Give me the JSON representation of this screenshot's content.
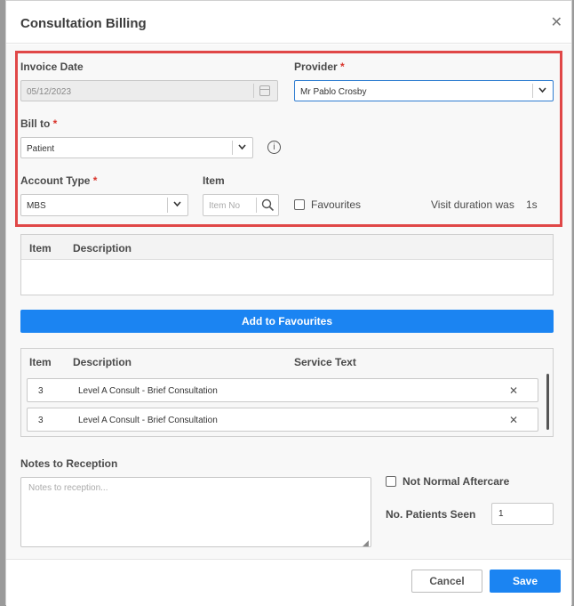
{
  "dialog": {
    "title": "Consultation Billing"
  },
  "form": {
    "invoice_date_label": "Invoice Date",
    "invoice_date_value": "05/12/2023",
    "provider_label": "Provider",
    "provider_value": "Mr Pablo Crosby",
    "bill_to_label": "Bill to",
    "bill_to_value": "Patient",
    "account_type_label": "Account Type",
    "account_type_value": "MBS",
    "item_label": "Item",
    "item_placeholder": "Item No",
    "favourites_label": "Favourites",
    "visit_duration_label": "Visit duration was",
    "visit_duration_value": "1s",
    "required_mark": "*"
  },
  "search_table": {
    "headers": [
      "Item",
      "Description"
    ]
  },
  "add_favourites_label": "Add to Favourites",
  "selected_table": {
    "headers": [
      "Item",
      "Description",
      "Service Text"
    ],
    "rows": [
      {
        "item": "3",
        "description": "Level A Consult - Brief Consultation"
      },
      {
        "item": "3",
        "description": "Level A Consult - Brief Consultation"
      }
    ]
  },
  "notes": {
    "label": "Notes to Reception",
    "placeholder": "Notes to reception..."
  },
  "aftercare": {
    "not_normal_label": "Not Normal Aftercare",
    "patients_seen_label": "No. Patients Seen",
    "patients_seen_value": "1"
  },
  "footer": {
    "cancel_label": "Cancel",
    "save_label": "Save"
  },
  "colors": {
    "accent": "#1b84f2",
    "highlight": "#e04747",
    "required": "#d9352c"
  }
}
